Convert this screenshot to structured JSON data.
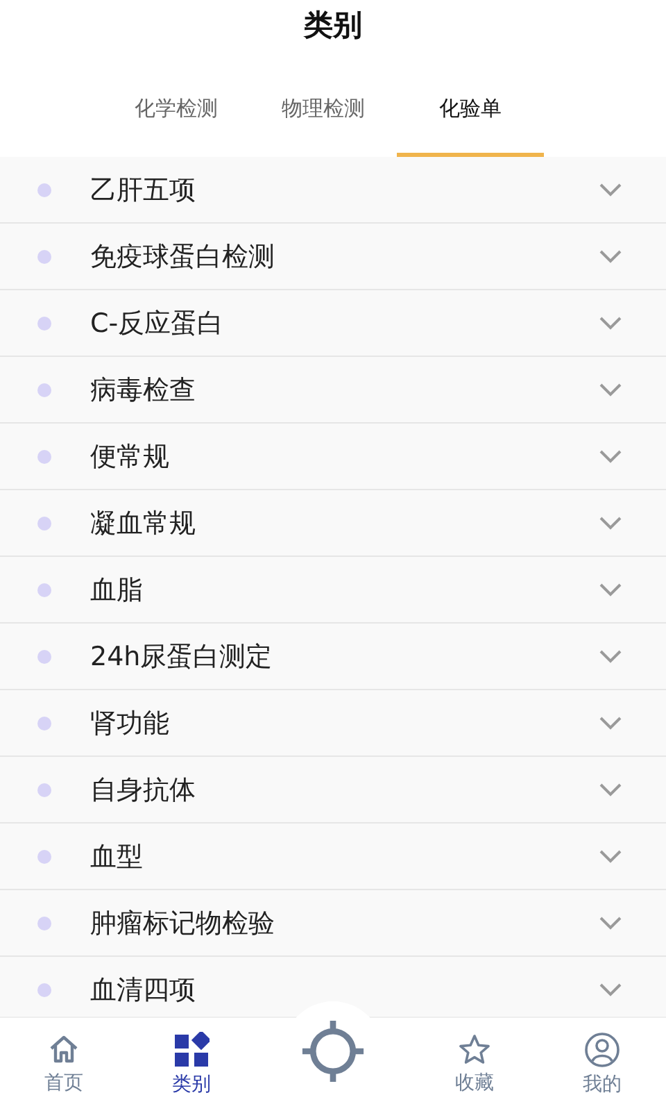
{
  "title": "类别",
  "tabs": [
    {
      "label": "化学检测",
      "selected": false
    },
    {
      "label": "物理检测",
      "selected": false
    },
    {
      "label": "化验单",
      "selected": true
    }
  ],
  "items": [
    {
      "label": "乙肝五项",
      "expanded": false
    },
    {
      "label": "免疫球蛋白检测",
      "expanded": false
    },
    {
      "label": "C-反应蛋白",
      "expanded": false
    },
    {
      "label": "病毒检查",
      "expanded": false
    },
    {
      "label": "便常规",
      "expanded": false
    },
    {
      "label": "凝血常规",
      "expanded": false
    },
    {
      "label": "血脂",
      "expanded": false
    },
    {
      "label": "24h尿蛋白测定",
      "expanded": false
    },
    {
      "label": "肾功能",
      "expanded": false
    },
    {
      "label": "自身抗体",
      "expanded": false
    },
    {
      "label": "血型",
      "expanded": false
    },
    {
      "label": "肿瘤标记物检验",
      "expanded": false
    },
    {
      "label": "血清四项",
      "expanded": false
    }
  ],
  "nav": [
    {
      "kind": "home",
      "label": "首页",
      "selected": false
    },
    {
      "kind": "category",
      "label": "类别",
      "selected": true
    },
    {
      "kind": "locate",
      "selected": false
    },
    {
      "kind": "favorite",
      "label": "收藏",
      "selected": false
    },
    {
      "kind": "profile",
      "label": "我的",
      "selected": false
    }
  ]
}
